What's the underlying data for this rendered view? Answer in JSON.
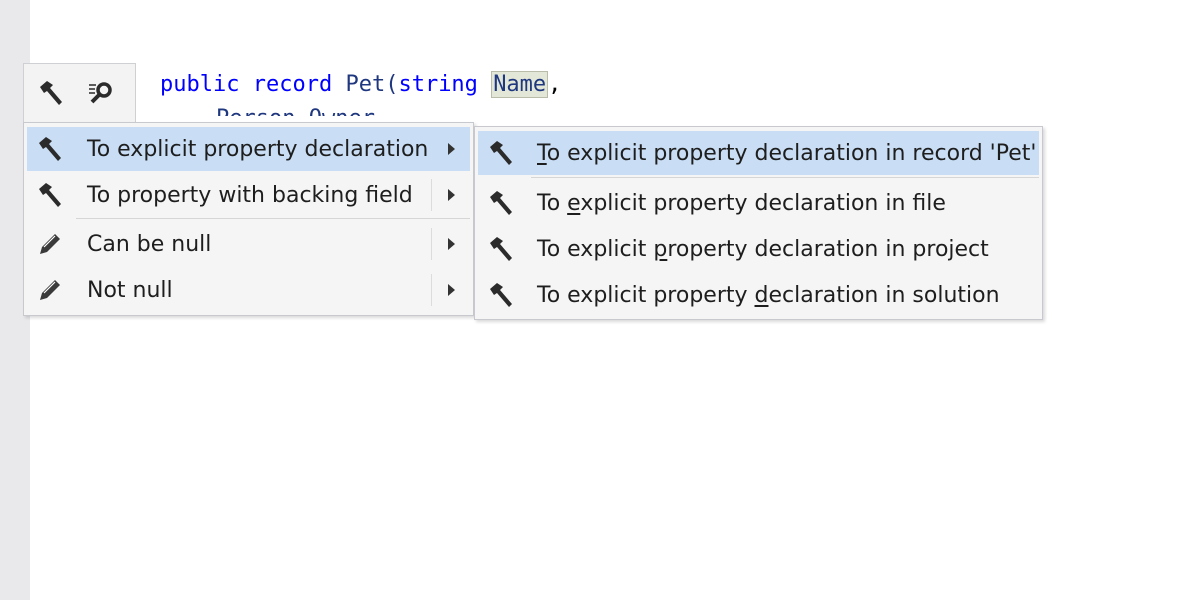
{
  "code": {
    "line1": {
      "kw1": "public",
      "kw2": "record",
      "name": "Pet(",
      "kw3": "string",
      "param": "Name",
      "tail": ","
    },
    "line2": "Person Owner"
  },
  "toolbar": {
    "buttons": [
      {
        "icon": "hammer-icon"
      },
      {
        "icon": "search-actions-icon"
      }
    ]
  },
  "menu": {
    "items": [
      {
        "label": "To explicit property declaration",
        "icon": "hammer-icon",
        "selected": true
      },
      {
        "label": "To property with backing field",
        "icon": "hammer-icon"
      },
      {
        "label": "Can be null",
        "icon": "pencil-icon"
      },
      {
        "label": "Not null",
        "icon": "pencil-icon"
      }
    ]
  },
  "submenu": {
    "items": [
      {
        "pre": "",
        "key": "T",
        "post": "o explicit property declaration in record 'Pet'",
        "selected": true
      },
      {
        "pre": "To ",
        "key": "e",
        "post": "xplicit property declaration in file"
      },
      {
        "pre": "To explicit ",
        "key": "p",
        "post": "roperty declaration in project"
      },
      {
        "pre": "To explicit property ",
        "key": "d",
        "post": "eclaration in solution"
      }
    ]
  },
  "colors": {
    "selection": "#c9def5",
    "keyword": "#0000ff",
    "type": "#1f377f"
  }
}
